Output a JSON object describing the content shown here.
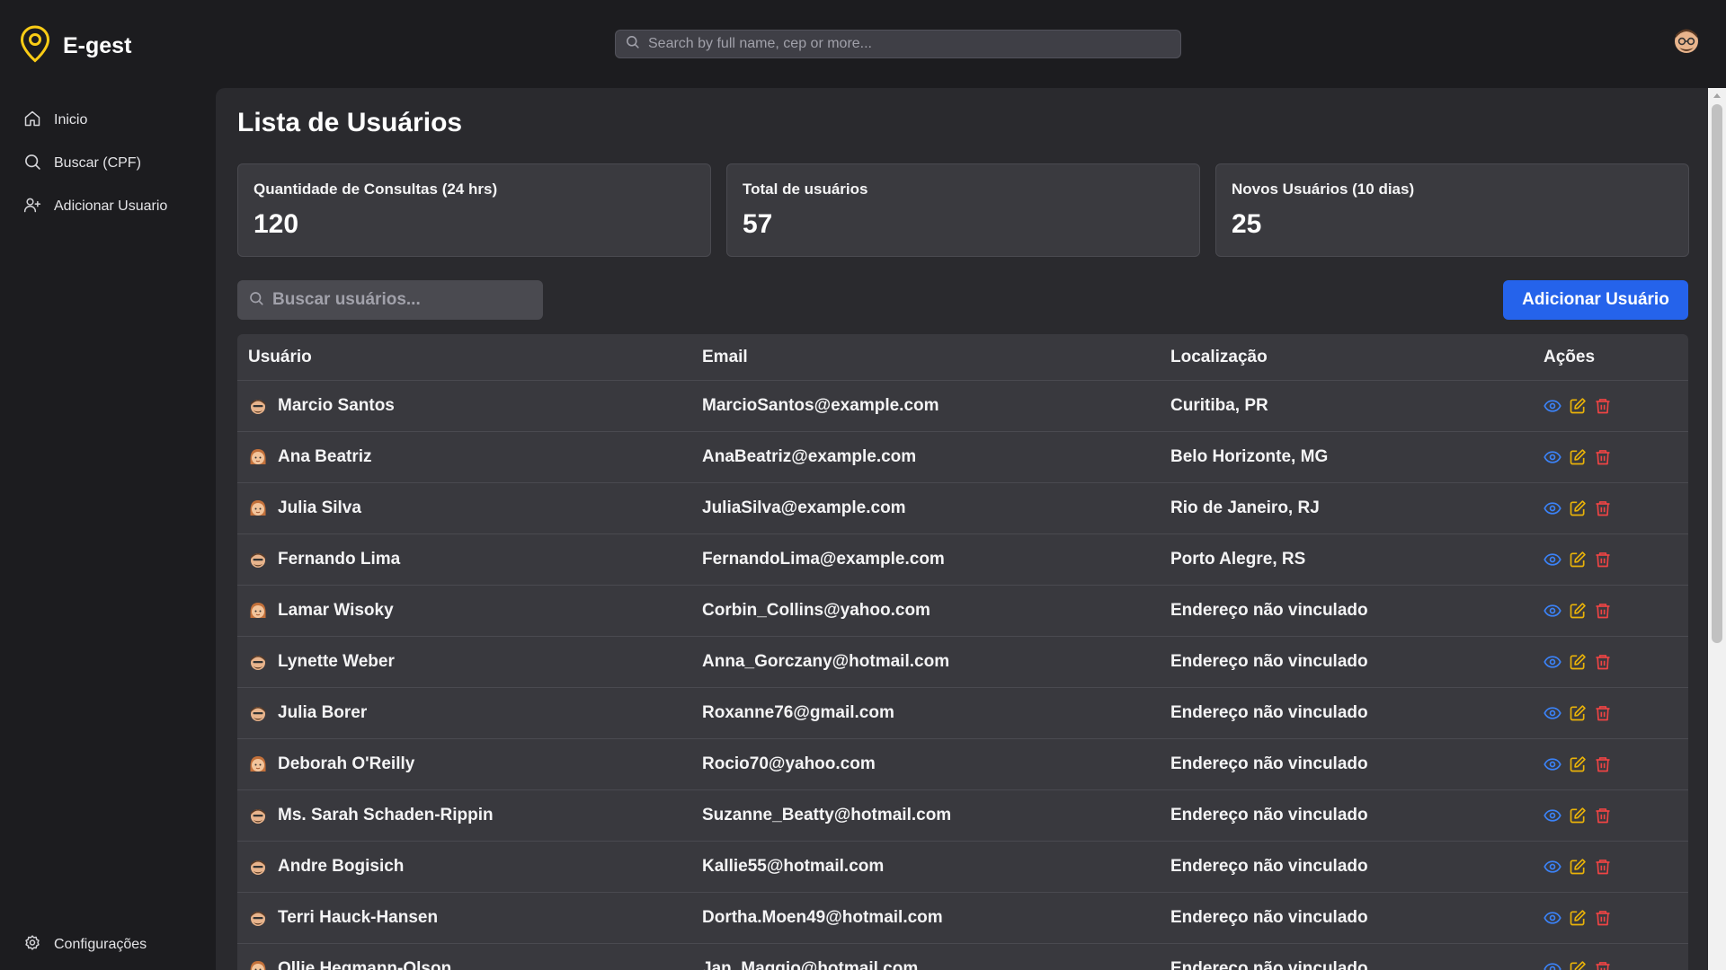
{
  "app": {
    "name": "E-gest",
    "search_placeholder": "Search by full name, cep or more..."
  },
  "sidebar": {
    "items": [
      {
        "label": "Inicio",
        "icon": "home-icon"
      },
      {
        "label": "Buscar (CPF)",
        "icon": "search-icon"
      },
      {
        "label": "Adicionar Usuario",
        "icon": "user-plus-icon"
      }
    ],
    "settings_label": "Configurações"
  },
  "page": {
    "title": "Lista de Usuários",
    "stats": [
      {
        "label": "Quantidade de Consultas (24 hrs)",
        "value": "120"
      },
      {
        "label": "Total de usuários",
        "value": "57"
      },
      {
        "label": "Novos Usuários (10 dias)",
        "value": "25"
      }
    ],
    "search_placeholder": "Buscar usuários...",
    "add_button": "Adicionar Usuário"
  },
  "table": {
    "headers": {
      "user": "Usuário",
      "email": "Email",
      "location": "Localização",
      "actions": "Ações"
    },
    "rows": [
      {
        "name": "Marcio Santos",
        "email": "MarcioSantos@example.com",
        "location": "Curitiba, PR",
        "avatar": "male-avatar"
      },
      {
        "name": "Ana Beatriz",
        "email": "AnaBeatriz@example.com",
        "location": "Belo Horizonte, MG",
        "avatar": "female-avatar"
      },
      {
        "name": "Julia Silva",
        "email": "JuliaSilva@example.com",
        "location": "Rio de Janeiro, RJ",
        "avatar": "female-avatar"
      },
      {
        "name": "Fernando Lima",
        "email": "FernandoLima@example.com",
        "location": "Porto Alegre, RS",
        "avatar": "male-avatar"
      },
      {
        "name": "Lamar Wisoky",
        "email": "Corbin_Collins@yahoo.com",
        "location": "Endereço não vinculado",
        "avatar": "female-avatar"
      },
      {
        "name": "Lynette Weber",
        "email": "Anna_Gorczany@hotmail.com",
        "location": "Endereço não vinculado",
        "avatar": "male-avatar"
      },
      {
        "name": "Julia Borer",
        "email": "Roxanne76@gmail.com",
        "location": "Endereço não vinculado",
        "avatar": "male-avatar"
      },
      {
        "name": "Deborah O'Reilly",
        "email": "Rocio70@yahoo.com",
        "location": "Endereço não vinculado",
        "avatar": "female-avatar"
      },
      {
        "name": "Ms. Sarah Schaden-Rippin",
        "email": "Suzanne_Beatty@hotmail.com",
        "location": "Endereço não vinculado",
        "avatar": "male-avatar"
      },
      {
        "name": "Andre Bogisich",
        "email": "Kallie55@hotmail.com",
        "location": "Endereço não vinculado",
        "avatar": "male-avatar"
      },
      {
        "name": "Terri Hauck-Hansen",
        "email": "Dortha.Moen49@hotmail.com",
        "location": "Endereço não vinculado",
        "avatar": "male-avatar"
      },
      {
        "name": "Ollie Hegmann-Olson",
        "email": "Jan_Maggio@hotmail.com",
        "location": "Endereço não vinculado",
        "avatar": "female-avatar"
      }
    ]
  },
  "colors": {
    "accent": "#2563eb",
    "view_icon": "#3b82f6",
    "edit_icon": "#eab308",
    "delete_icon": "#ef4444",
    "logo": "#facc15"
  }
}
